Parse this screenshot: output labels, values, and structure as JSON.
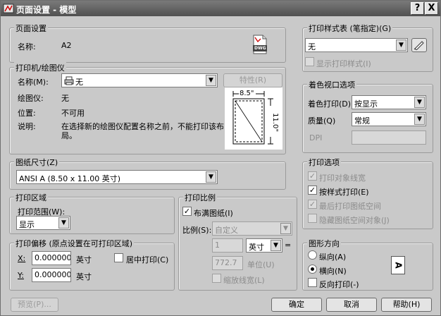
{
  "window": {
    "title": "页面设置 - 模型",
    "help_btn": "?",
    "close_btn": "X"
  },
  "page_setup": {
    "group_title": "页面设置",
    "name_label": "名称:",
    "name_value": "A2",
    "file_icon_text": "DWG"
  },
  "printer": {
    "group_title": "打印机/绘图仪",
    "name_label": "名称(M):",
    "name_value": "无",
    "properties_btn": "特性(R)",
    "plotter_label": "绘图仪:",
    "plotter_value": "无",
    "location_label": "位置:",
    "location_value": "不可用",
    "desc_label": "说明:",
    "desc_line1": "在选择新的绘图仪配置名称之前，不能打印该布",
    "desc_line2": "局。",
    "preview_width": "8.5\"",
    "preview_height": "11.0\""
  },
  "paper_size": {
    "group_title": "图纸尺寸(Z)",
    "value": "ANSI A (8.50 x 11.00 英寸)"
  },
  "plot_area": {
    "group_title": "打印区域",
    "range_label": "打印范围(W):",
    "range_value": "显示"
  },
  "plot_offset": {
    "group_title": "打印偏移 (原点设置在可打印区域)",
    "x_label": "X:",
    "x_value": "0.000000",
    "x_unit": "英寸",
    "y_label": "Y:",
    "y_value": "0.000000",
    "y_unit": "英寸",
    "center_label": "居中打印(C)"
  },
  "plot_scale": {
    "group_title": "打印比例",
    "fit_label": "布满图纸(I)",
    "fit_checked": true,
    "scale_label": "比例(S):",
    "scale_value": "自定义",
    "value1": "1",
    "unit_value": "英寸",
    "equals": "=",
    "value2": "772.7",
    "unit2_label": "单位(U)",
    "lineweight_label": "缩放线宽(L)"
  },
  "plot_style_table": {
    "group_title": "打印样式表 (笔指定)(G)",
    "value": "无",
    "display_label": "显示打印样式(I)"
  },
  "shaded_viewport": {
    "group_title": "着色视口选项",
    "shade_label": "着色打印(D)",
    "shade_value": "按显示",
    "quality_label": "质量(Q)",
    "quality_value": "常规",
    "dpi_label": "DPI"
  },
  "plot_options": {
    "group_title": "打印选项",
    "items": [
      {
        "label": "打印对象线宽",
        "checked": true,
        "enabled": false
      },
      {
        "label": "按样式打印(E)",
        "checked": true,
        "enabled": true
      },
      {
        "label": "最后打印图纸空间",
        "checked": true,
        "enabled": false
      },
      {
        "label": "隐藏图纸空间对象(J)",
        "checked": false,
        "enabled": false
      }
    ]
  },
  "orientation": {
    "group_title": "图形方向",
    "portrait_label": "纵向(A)",
    "landscape_label": "横向(N)",
    "reverse_label": "反向打印(-)",
    "selected": "landscape",
    "icon_letter": "A"
  },
  "footer": {
    "preview_btn": "预览(P)...",
    "ok_btn": "确定",
    "cancel_btn": "取消",
    "help_btn": "帮助(H)"
  }
}
